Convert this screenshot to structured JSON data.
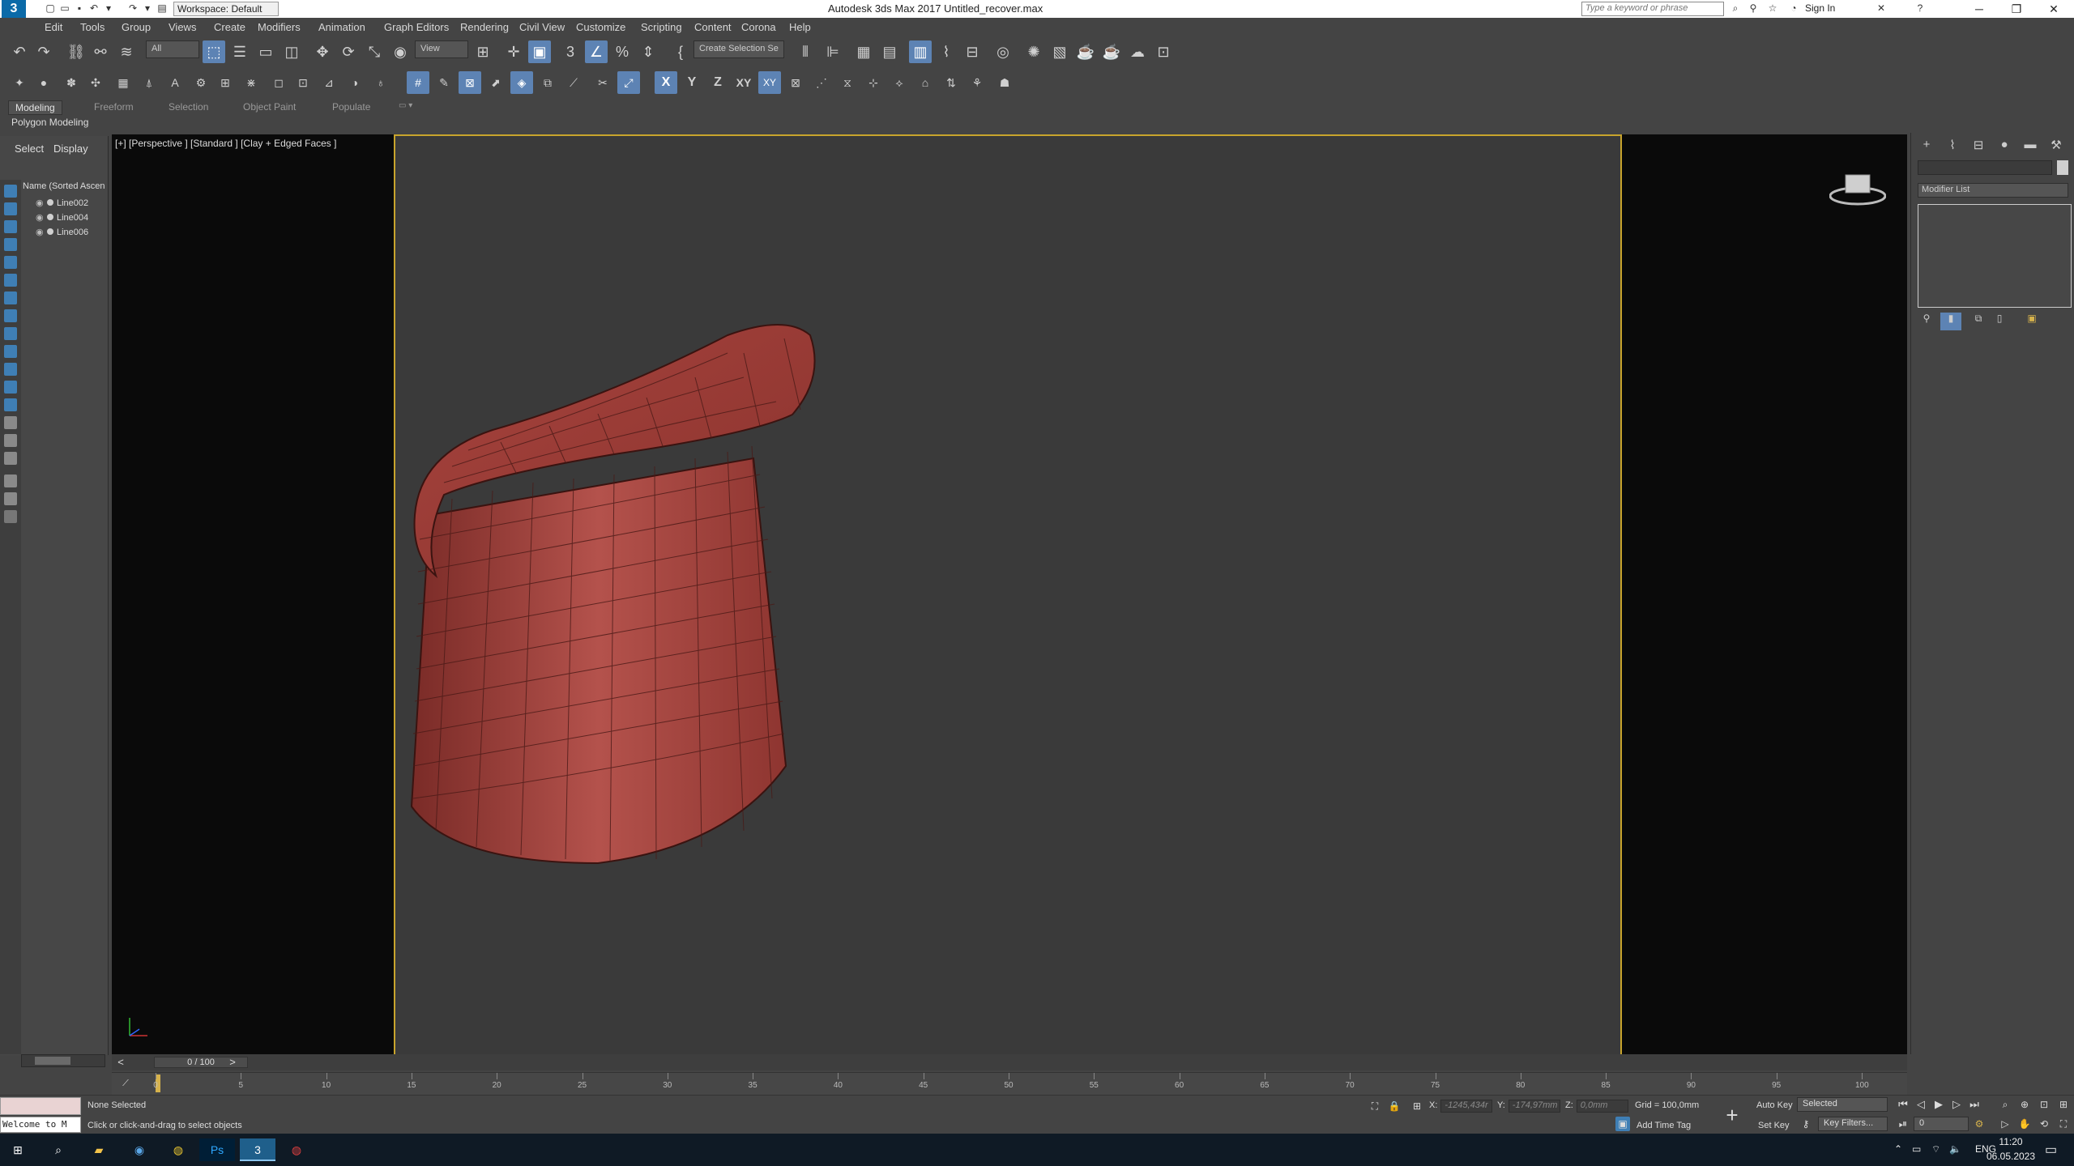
{
  "app": {
    "title": "Autodesk 3ds Max 2017    Untitled_recover.max",
    "logo_glyph": "3",
    "workspace": "Workspace: Default",
    "search_placeholder": "Type a keyword or phrase",
    "sign_in": "Sign In"
  },
  "menu": [
    "Edit",
    "Tools",
    "Group",
    "Views",
    "Create",
    "Modifiers",
    "Animation",
    "Graph Editors",
    "Rendering",
    "Civil View",
    "Customize",
    "Scripting",
    "Content",
    "Corona",
    "Help"
  ],
  "toolbar": {
    "selection_filter": "All",
    "ref_coord": "View",
    "named_selection": "Create Selection Se"
  },
  "ribbon": {
    "tabs": [
      "Modeling",
      "Freeform",
      "Selection",
      "Object Paint",
      "Populate"
    ],
    "active_tab": "Modeling",
    "sub_label": "Polygon Modeling"
  },
  "scene_explorer": {
    "tabs": [
      "Select",
      "Display"
    ],
    "column_header": "Name (Sorted Ascen",
    "objects": [
      "Line002",
      "Line004",
      "Line006"
    ]
  },
  "viewport": {
    "label": "[+] [Perspective ] [Standard ] [Clay + Edged Faces ]",
    "object_color": "#a5423d",
    "frame_color": "#c8a42c"
  },
  "command_panel": {
    "modifier_list": "Modifier List"
  },
  "timeline": {
    "frame_display": "0 / 100",
    "ticks": [
      "0",
      "5",
      "10",
      "15",
      "20",
      "25",
      "30",
      "35",
      "40",
      "45",
      "50",
      "55",
      "60",
      "65",
      "70",
      "75",
      "80",
      "85",
      "90",
      "95",
      "100"
    ]
  },
  "status": {
    "selection": "None Selected",
    "prompt": "Click or click-and-drag to select objects",
    "maxscript": "Welcome to M",
    "x_label": "X:",
    "x_value": "-1245,434r",
    "y_label": "Y:",
    "y_value": "-174,97mm",
    "z_label": "Z:",
    "z_value": "0,0mm",
    "grid": "Grid = 100,0mm",
    "add_time_tag": "Add Time Tag",
    "auto_key": "Auto Key",
    "set_key": "Set Key",
    "key_mode": "Selected",
    "key_filters": "Key Filters...",
    "current_frame": "0"
  },
  "taskbar": {
    "language": "ENG",
    "time": "11:20",
    "date": "06.05.2023"
  }
}
